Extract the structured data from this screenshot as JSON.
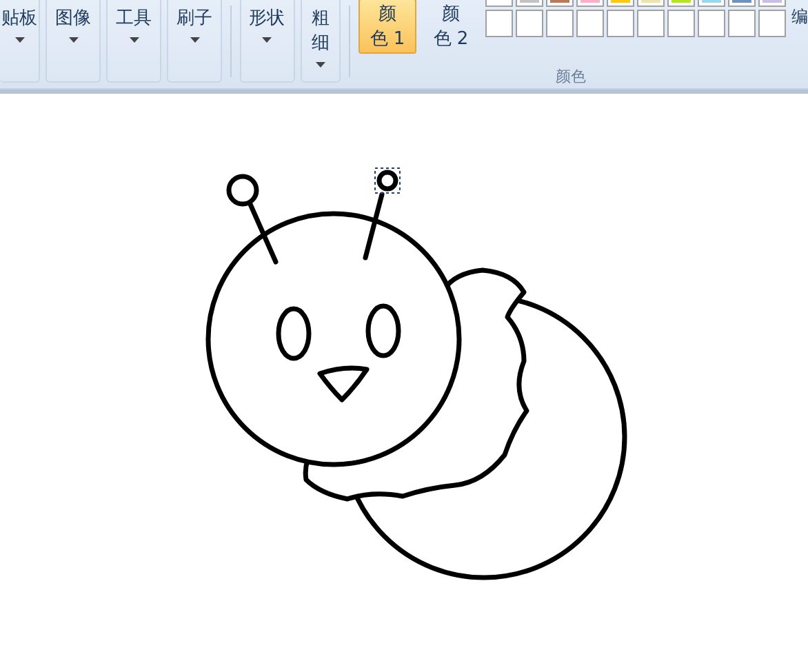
{
  "ribbon": {
    "tool_groups": [
      {
        "lines": [
          "贴板"
        ],
        "caret": true
      },
      {
        "lines": [
          "图像"
        ],
        "caret": true
      },
      {
        "lines": [
          "工具"
        ],
        "caret": true
      },
      {
        "lines": [
          "刷子"
        ],
        "caret": true
      },
      {
        "lines": [
          "形状"
        ],
        "caret": true
      },
      {
        "lines": [
          "粗",
          "细"
        ],
        "caret": true
      }
    ],
    "color_buttons": [
      {
        "lines": [
          "颜",
          "色 1"
        ],
        "selected": true
      },
      {
        "lines": [
          "颜",
          "色 2"
        ],
        "selected": false
      }
    ],
    "palette": [
      [
        {
          "color": "#ffffff"
        },
        {
          "color": "#c3c3c3"
        },
        {
          "color": "#b97a57"
        },
        {
          "color": "#ffaec9"
        },
        {
          "color": "#ffc90e"
        },
        {
          "color": "#efe4b0"
        },
        {
          "color": "#b5e61d"
        },
        {
          "color": "#99d9ea"
        },
        {
          "color": "#7092be"
        },
        {
          "color": "#c8bfe7"
        }
      ]
    ],
    "edit_colors": "编",
    "color_group_label": "颜色"
  }
}
